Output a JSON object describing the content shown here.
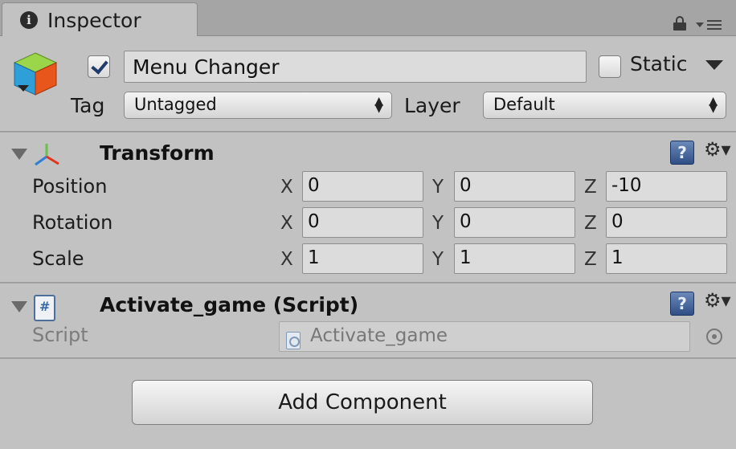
{
  "tab": {
    "title": "Inspector",
    "info_glyph": "i"
  },
  "header": {
    "active": true,
    "name": "Menu Changer",
    "static_label": "Static",
    "static": false,
    "tag_label": "Tag",
    "tag_value": "Untagged",
    "layer_label": "Layer",
    "layer_value": "Default",
    "dropdown_arrows": "⬍"
  },
  "transform": {
    "title": "Transform",
    "help_glyph": "?",
    "gear_glyph": "⚙▾",
    "rows": [
      {
        "label": "Position",
        "x": "0",
        "y": "0",
        "z": "-10"
      },
      {
        "label": "Rotation",
        "x": "0",
        "y": "0",
        "z": "0"
      },
      {
        "label": "Scale",
        "x": "1",
        "y": "1",
        "z": "1"
      }
    ],
    "axis_x": "X",
    "axis_y": "Y",
    "axis_z": "Z"
  },
  "script_component": {
    "title": "Activate_game (Script)",
    "help_glyph": "?",
    "gear_glyph": "⚙▾",
    "script_label": "Script",
    "script_value": "Activate_game"
  },
  "add_component_label": "Add Component",
  "colors": {
    "panel": "#c2c2c2",
    "background": "#a5a5a5",
    "field": "#dcdcdc",
    "help_blue": "#2f4f86"
  },
  "icons": [
    "info-icon",
    "lock-icon",
    "tab-menu-icon",
    "gameobject-cube-icon",
    "transform-axes-icon",
    "csharp-script-icon",
    "help-icon",
    "gear-icon",
    "object-picker-icon"
  ]
}
